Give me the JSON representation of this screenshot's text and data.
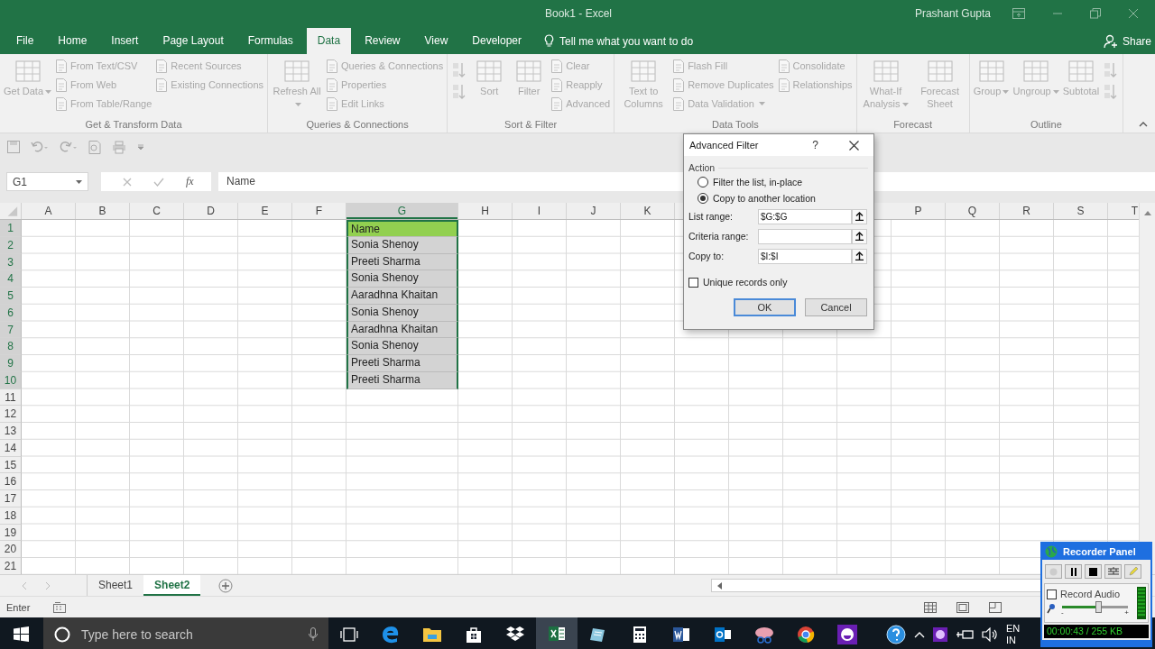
{
  "window": {
    "title": "Book1 - Excel",
    "user": "Prashant Gupta"
  },
  "ribbon_tabs": [
    {
      "label": "File",
      "selected": false
    },
    {
      "label": "Home",
      "selected": false
    },
    {
      "label": "Insert",
      "selected": false
    },
    {
      "label": "Page Layout",
      "selected": false
    },
    {
      "label": "Formulas",
      "selected": false
    },
    {
      "label": "Data",
      "selected": true
    },
    {
      "label": "Review",
      "selected": false
    },
    {
      "label": "View",
      "selected": false
    },
    {
      "label": "Developer",
      "selected": false
    }
  ],
  "tell_me": "Tell me what you want to do",
  "share": "Share",
  "ribbon_groups": [
    {
      "label": "Get & Transform Data",
      "items": [
        {
          "kind": "large",
          "label": "Get Data",
          "dropdown": true
        },
        {
          "kind": "small",
          "label": "From Text/CSV"
        },
        {
          "kind": "small",
          "label": "From Web"
        },
        {
          "kind": "small",
          "label": "From Table/Range"
        },
        {
          "kind": "small",
          "label": "Recent Sources"
        },
        {
          "kind": "small",
          "label": "Existing Connections"
        }
      ]
    },
    {
      "label": "Queries & Connections",
      "items": [
        {
          "kind": "large",
          "label": "Refresh All",
          "dropdown": true
        },
        {
          "kind": "small",
          "label": "Queries & Connections"
        },
        {
          "kind": "small",
          "label": "Properties"
        },
        {
          "kind": "small",
          "label": "Edit Links"
        }
      ]
    },
    {
      "label": "Sort & Filter",
      "items": [
        {
          "kind": "icon_stack"
        },
        {
          "kind": "large",
          "label": "Sort",
          "dropdown": false
        },
        {
          "kind": "large",
          "label": "Filter",
          "dropdown": false
        },
        {
          "kind": "small",
          "label": "Clear"
        },
        {
          "kind": "small",
          "label": "Reapply"
        },
        {
          "kind": "small",
          "label": "Advanced"
        }
      ]
    },
    {
      "label": "Data Tools",
      "items": [
        {
          "kind": "large",
          "label": "Text to Columns",
          "dropdown": false
        },
        {
          "kind": "small",
          "label": "Flash Fill"
        },
        {
          "kind": "small",
          "label": "Remove Duplicates"
        },
        {
          "kind": "small",
          "label": "Data Validation",
          "dropdown": true
        },
        {
          "kind": "small",
          "label": "Consolidate"
        },
        {
          "kind": "small",
          "label": "Relationships"
        }
      ]
    },
    {
      "label": "Forecast",
      "items": [
        {
          "kind": "large",
          "label": "What-If Analysis",
          "dropdown": true
        },
        {
          "kind": "large",
          "label": "Forecast Sheet",
          "dropdown": false
        }
      ]
    },
    {
      "label": "Outline",
      "items": [
        {
          "kind": "large",
          "label": "Group",
          "dropdown": true
        },
        {
          "kind": "large",
          "label": "Ungroup",
          "dropdown": true
        },
        {
          "kind": "large",
          "label": "Subtotal",
          "dropdown": false
        },
        {
          "kind": "icon_stack"
        }
      ]
    }
  ],
  "formula_bar": {
    "name_box": "G1",
    "function_label": "fx",
    "value": "Name"
  },
  "sheet": {
    "columns": [
      {
        "label": "A",
        "selected": false
      },
      {
        "label": "B",
        "selected": false
      },
      {
        "label": "C",
        "selected": false
      },
      {
        "label": "D",
        "selected": false
      },
      {
        "label": "E",
        "selected": false
      },
      {
        "label": "F",
        "selected": false
      },
      {
        "label": "G",
        "selected": true
      },
      {
        "label": "H",
        "selected": false
      },
      {
        "label": "I",
        "selected": false
      },
      {
        "label": "J",
        "selected": false
      },
      {
        "label": "K",
        "selected": false
      },
      {
        "label": "P",
        "selected": false
      },
      {
        "label": "Q",
        "selected": false
      },
      {
        "label": "R",
        "selected": false
      },
      {
        "label": "S",
        "selected": false
      },
      {
        "label": "T",
        "selected": false
      }
    ],
    "rows": [
      {
        "number": "1",
        "selected": true,
        "g": {
          "text": "Name",
          "kind": "header"
        }
      },
      {
        "number": "2",
        "selected": true,
        "g": {
          "text": "Sonia Shenoy",
          "kind": "data"
        }
      },
      {
        "number": "3",
        "selected": true,
        "g": {
          "text": "Preeti Sharma",
          "kind": "data"
        }
      },
      {
        "number": "4",
        "selected": true,
        "g": {
          "text": "Sonia Shenoy",
          "kind": "data"
        }
      },
      {
        "number": "5",
        "selected": true,
        "g": {
          "text": "Aaradhna Khaitan",
          "kind": "data"
        }
      },
      {
        "number": "6",
        "selected": true,
        "g": {
          "text": "Sonia Shenoy",
          "kind": "data"
        }
      },
      {
        "number": "7",
        "selected": true,
        "g": {
          "text": "Aaradhna Khaitan",
          "kind": "data"
        }
      },
      {
        "number": "8",
        "selected": true,
        "g": {
          "text": "Sonia Shenoy",
          "kind": "data"
        }
      },
      {
        "number": "9",
        "selected": true,
        "g": {
          "text": "Preeti Sharma",
          "kind": "data"
        }
      },
      {
        "number": "10",
        "selected": true,
        "g": {
          "text": "Preeti Sharma",
          "kind": "data"
        }
      },
      {
        "number": "11",
        "selected": false
      },
      {
        "number": "12",
        "selected": false
      },
      {
        "number": "13",
        "selected": false
      },
      {
        "number": "14",
        "selected": false
      },
      {
        "number": "15",
        "selected": false
      },
      {
        "number": "16",
        "selected": false
      },
      {
        "number": "17",
        "selected": false
      },
      {
        "number": "18",
        "selected": false
      },
      {
        "number": "19",
        "selected": false
      },
      {
        "number": "20",
        "selected": false
      },
      {
        "number": "21",
        "selected": false
      }
    ]
  },
  "sheet_tabs": [
    {
      "label": "Sheet1",
      "selected": false
    },
    {
      "label": "Sheet2",
      "selected": true
    }
  ],
  "status_bar": {
    "mode": "Enter"
  },
  "dialog": {
    "title": "Advanced Filter",
    "help": "?",
    "section": "Action",
    "options": [
      {
        "label": "Filter the list, in-place",
        "selected": false
      },
      {
        "label": "Copy to another location",
        "selected": true
      }
    ],
    "fields": [
      {
        "label": "List range:",
        "value": "$G:$G"
      },
      {
        "label": "Criteria range:"
      },
      {
        "label": "Copy to:",
        "value": "$I:$I"
      }
    ],
    "unique": {
      "label": "Unique records only",
      "checked": false
    },
    "buttons": [
      {
        "label": "OK",
        "default": true
      },
      {
        "label": "Cancel",
        "default": false
      }
    ]
  },
  "taskbar": {
    "search_placeholder": "Type here to search",
    "apps": [
      {
        "kind": "task_view",
        "selected": false
      },
      {
        "kind": "edge",
        "selected": false
      },
      {
        "kind": "explorer",
        "selected": false
      },
      {
        "kind": "store",
        "selected": false
      },
      {
        "kind": "dropbox",
        "selected": false
      },
      {
        "kind": "excel",
        "selected": true
      },
      {
        "kind": "notes",
        "selected": false
      },
      {
        "kind": "calculator",
        "selected": false
      },
      {
        "kind": "word",
        "selected": false
      },
      {
        "kind": "outlook",
        "selected": false
      },
      {
        "kind": "snipping",
        "selected": false
      },
      {
        "kind": "chrome",
        "selected": false
      },
      {
        "kind": "messenger",
        "selected": false
      }
    ],
    "language": [
      "EN",
      "IN"
    ]
  },
  "recorder": {
    "title": "Recorder Panel",
    "record_audio": {
      "label": "Record Audio",
      "checked": false
    },
    "volume": {
      "level": 0.55,
      "min": "-",
      "max": "+"
    },
    "status": "00:00:43 / 255 KB"
  }
}
